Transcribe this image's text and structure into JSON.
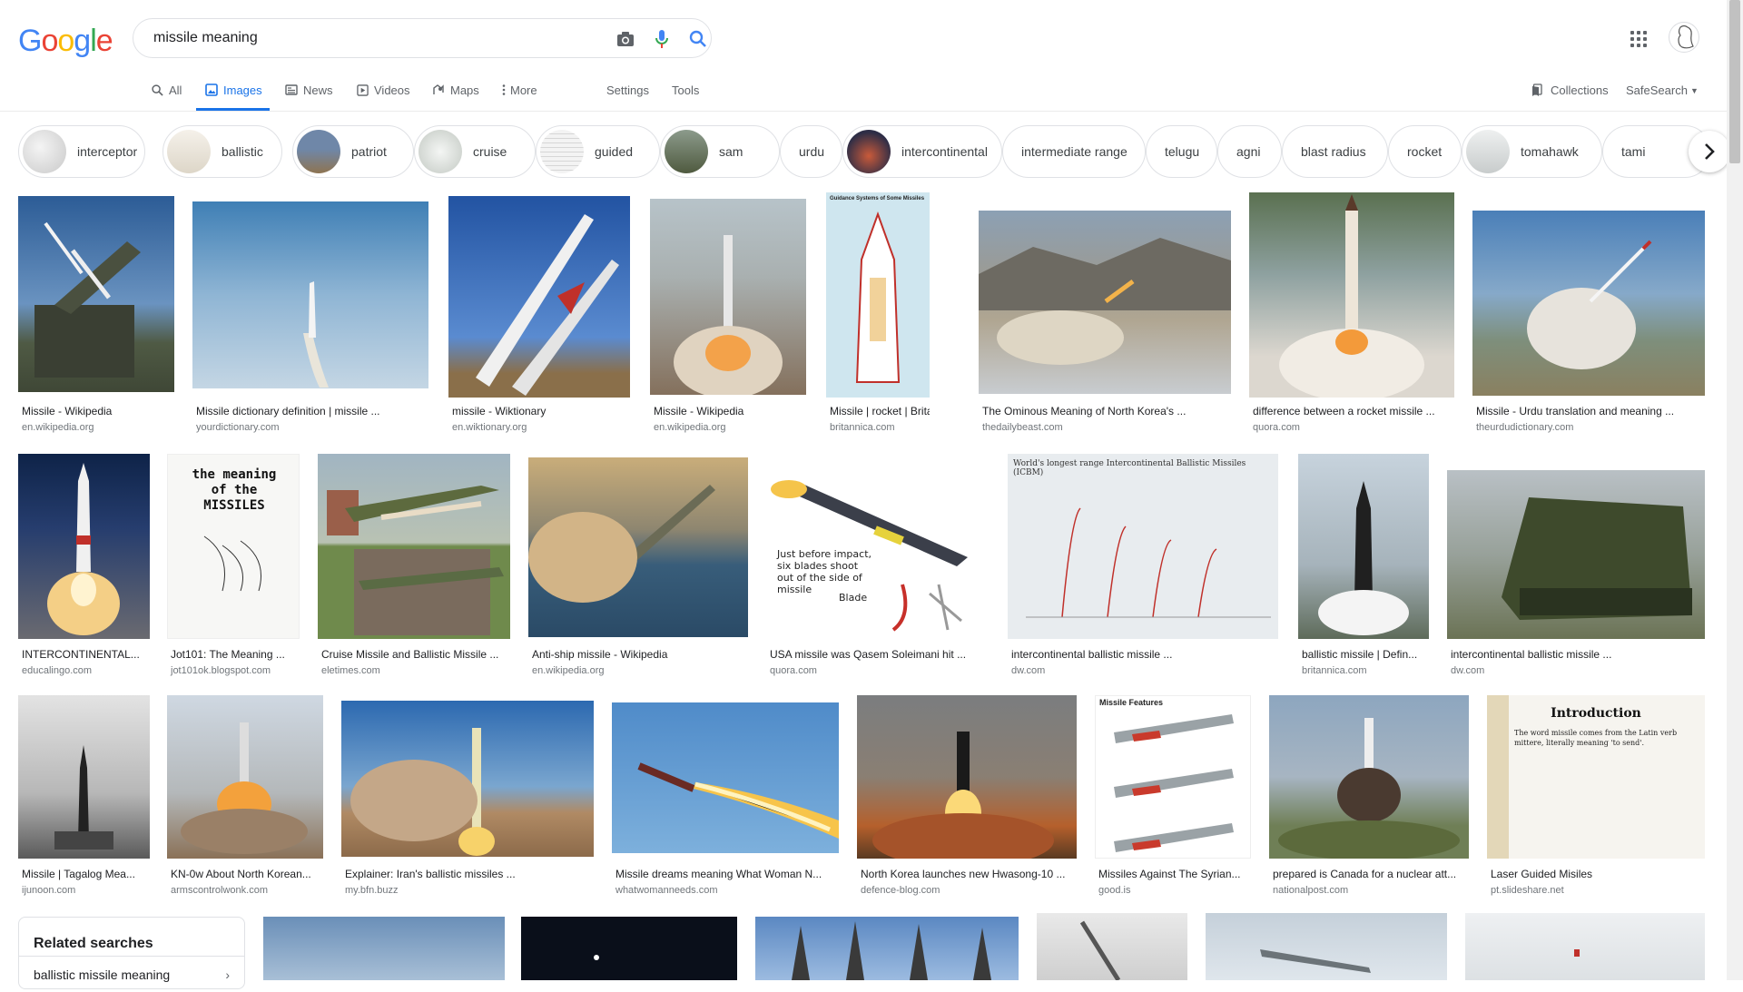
{
  "logo": {
    "letters": [
      "G",
      "o",
      "o",
      "g",
      "l",
      "e"
    ],
    "colors": [
      "#4285F4",
      "#EA4335",
      "#FBBC05",
      "#4285F4",
      "#34A853",
      "#EA4335"
    ]
  },
  "search": {
    "value": "missile meaning",
    "placeholder": ""
  },
  "tabs": [
    {
      "label": "All",
      "icon": "search-icon"
    },
    {
      "label": "Images",
      "icon": "image-icon"
    },
    {
      "label": "News",
      "icon": "news-icon"
    },
    {
      "label": "Videos",
      "icon": "play-icon"
    },
    {
      "label": "Maps",
      "icon": "map-pin-icon"
    },
    {
      "label": "More",
      "icon": "more-vert-icon"
    },
    {
      "label": "Settings"
    },
    {
      "label": "Tools"
    }
  ],
  "header_right": {
    "collections": "Collections",
    "safesearch": "SafeSearch"
  },
  "chips": [
    {
      "label": "interceptor"
    },
    {
      "label": "ballistic"
    },
    {
      "label": "patriot"
    },
    {
      "label": "cruise"
    },
    {
      "label": "guided"
    },
    {
      "label": "sam"
    },
    {
      "label": "urdu"
    },
    {
      "label": "intercontinental"
    },
    {
      "label": "intermediate range"
    },
    {
      "label": "telugu"
    },
    {
      "label": "agni"
    },
    {
      "label": "blast radius"
    },
    {
      "label": "rocket"
    },
    {
      "label": "tomahawk"
    },
    {
      "label": "tami"
    }
  ],
  "results": [
    {
      "title": "Missile - Wikipedia",
      "source": "en.wikipedia.org"
    },
    {
      "title": "Missile dictionary definition | missile ...",
      "source": "yourdictionary.com"
    },
    {
      "title": "missile - Wiktionary",
      "source": "en.wiktionary.org"
    },
    {
      "title": "Missile - Wikipedia",
      "source": "en.wikipedia.org"
    },
    {
      "title": "Missile | rocket | Britan...",
      "source": "britannica.com"
    },
    {
      "title": "The Ominous Meaning of North Korea's ...",
      "source": "thedailybeast.com"
    },
    {
      "title": "difference between a rocket missile ...",
      "source": "quora.com"
    },
    {
      "title": "Missile - Urdu translation and meaning ...",
      "source": "theurdudictionary.com"
    },
    {
      "title": "INTERCONTINENTAL...",
      "source": "educalingo.com"
    },
    {
      "title": "Jot101: The Meaning ...",
      "source": "jot101ok.blogspot.com"
    },
    {
      "title": "Cruise Missile and Ballistic Missile ...",
      "source": "eletimes.com"
    },
    {
      "title": "Anti-ship missile - Wikipedia",
      "source": "en.wikipedia.org"
    },
    {
      "title": "USA missile was Qasem Soleimani hit ...",
      "source": "quora.com"
    },
    {
      "title": "intercontinental ballistic missile ...",
      "source": "dw.com"
    },
    {
      "title": "ballistic missile | Defin...",
      "source": "britannica.com"
    },
    {
      "title": "intercontinental ballistic missile ...",
      "source": "dw.com"
    },
    {
      "title": "Missile | Tagalog Mea...",
      "source": "ijunoon.com"
    },
    {
      "title": "KN-0w About North Korean...",
      "source": "armscontrolwonk.com"
    },
    {
      "title": "Explainer: Iran's ballistic missiles ...",
      "source": "my.bfn.buzz"
    },
    {
      "title": "Missile dreams meaning What Woman N...",
      "source": "whatwomanneeds.com"
    },
    {
      "title": "North Korea launches new Hwasong-10 ...",
      "source": "defence-blog.com"
    },
    {
      "title": "Missiles Against The Syrian...",
      "source": "good.is"
    },
    {
      "title": "prepared is Canada for a nuclear att...",
      "source": "nationalpost.com"
    },
    {
      "title": "Laser Guided Misiles",
      "source": "pt.slideshare.net"
    }
  ],
  "image_text": {
    "britannica_diagram": "Guidance Systems of Some Missiles",
    "jot_cover": [
      "the meaning",
      "of the",
      "MISSILES"
    ],
    "soleimani": [
      "Just before impact,",
      "six blades shoot",
      "out of the side of",
      "missile",
      "Blade"
    ],
    "icbm_chart": "World's longest range Intercontinental Ballistic Missiles (ICBM)",
    "features": "Missile Features",
    "intro_title": "Introduction",
    "intro_text": "The word missile comes from the Latin verb mittere, literally meaning 'to send'."
  },
  "related": {
    "title": "Related searches",
    "items": [
      "ballistic missile meaning"
    ]
  }
}
